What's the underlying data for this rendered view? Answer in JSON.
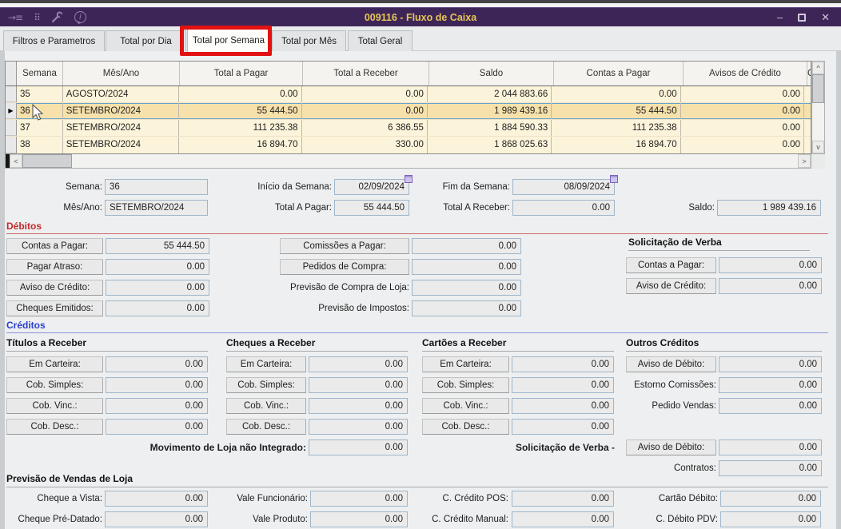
{
  "titlebar": {
    "title": "009116 - Fluxo de Caixa"
  },
  "icons": {
    "goto": "→≡",
    "status": "⠿",
    "info": "i",
    "minimize": "–",
    "close": "✕",
    "scroll_up": "^",
    "scroll_down": "v",
    "scroll_left": "<",
    "scroll_right": ">",
    "row_marker": "▶",
    "calendar": "calendar-grid"
  },
  "tabs": [
    {
      "label": "Filtros e Parametros"
    },
    {
      "label": "Total por Dia"
    },
    {
      "label": "Total por Semana"
    },
    {
      "label": "Total por Mês"
    },
    {
      "label": "Total Geral"
    }
  ],
  "active_tab": "Total por Semana",
  "table": {
    "headers": [
      "Semana",
      "Mês/Ano",
      "Total a Pagar",
      "Total a Receber",
      "Saldo",
      "Contas a Pagar",
      "Avisos de Crédito"
    ],
    "partial_header": "C",
    "selected_row": 1,
    "rows": [
      [
        "35",
        "AGOSTO/2024",
        "0.00",
        "0.00",
        "2 044 883.66",
        "0.00",
        "0.00"
      ],
      [
        "36",
        "SETEMBRO/2024",
        "55 444.50",
        "0.00",
        "1 989 439.16",
        "55 444.50",
        "0.00"
      ],
      [
        "37",
        "SETEMBRO/2024",
        "111 235.38",
        "6 386.55",
        "1 884 590.33",
        "111 235.38",
        "0.00"
      ],
      [
        "38",
        "SETEMBRO/2024",
        "16 894.70",
        "330.00",
        "1 868 025.63",
        "16 894.70",
        "0.00"
      ]
    ]
  },
  "summary": {
    "semana": {
      "label": "Semana:",
      "value": "36"
    },
    "inicio": {
      "label": "Início da Semana:",
      "value": "02/09/2024"
    },
    "fim": {
      "label": "Fim da Semana:",
      "value": "08/09/2024"
    },
    "mes_ano": {
      "label": "Mês/Ano:",
      "value": "SETEMBRO/2024"
    },
    "total_pagar": {
      "label": "Total A Pagar:",
      "value": "55 444.50"
    },
    "total_receber": {
      "label": "Total A Receber:",
      "value": "0.00"
    },
    "saldo": {
      "label": "Saldo:",
      "value": "1 989 439.16"
    }
  },
  "debitos": {
    "title": "Débitos",
    "contas_pagar": {
      "label": "Contas a Pagar:",
      "value": "55 444.50"
    },
    "pagar_atraso": {
      "label": "Pagar Atraso:",
      "value": "0.00"
    },
    "aviso_credito": {
      "label": "Aviso de Crédito:",
      "value": "0.00"
    },
    "cheques_emitidos": {
      "label": "Cheques Emitidos:",
      "value": "0.00"
    },
    "comissoes_pagar": {
      "label": "Comissões a Pagar:",
      "value": "0.00"
    },
    "pedidos_compra": {
      "label": "Pedidos de Compra:",
      "value": "0.00"
    },
    "previsao_compra_loja": {
      "label": "Previsão de Compra de Loja:",
      "value": "0.00"
    },
    "previsao_impostos": {
      "label": "Previsão de Impostos:",
      "value": "0.00"
    },
    "verba": {
      "title": "Solicitação de Verba",
      "contas_pagar": {
        "label": "Contas a Pagar:",
        "value": "0.00"
      },
      "aviso_credito": {
        "label": "Aviso de Crédito:",
        "value": "0.00"
      }
    }
  },
  "creditos": {
    "title": "Créditos",
    "titulos": {
      "title": "Títulos a Receber",
      "em_carteira": {
        "label": "Em Carteira:",
        "value": "0.00"
      },
      "cob_simples": {
        "label": "Cob. Simples:",
        "value": "0.00"
      },
      "cob_vinc": {
        "label": "Cob. Vinc.:",
        "value": "0.00"
      },
      "cob_desc": {
        "label": "Cob. Desc.:",
        "value": "0.00"
      }
    },
    "cheques": {
      "title": "Cheques a Receber",
      "em_carteira": {
        "label": "Em Carteira:",
        "value": "0.00"
      },
      "cob_simples": {
        "label": "Cob. Simples:",
        "value": "0.00"
      },
      "cob_vinc": {
        "label": "Cob. Vinc.:",
        "value": "0.00"
      },
      "cob_desc": {
        "label": "Cob. Desc.:",
        "value": "0.00"
      }
    },
    "cartoes": {
      "title": "Cartões a Receber",
      "em_carteira": {
        "label": "Em Carteira:",
        "value": "0.00"
      },
      "cob_simples": {
        "label": "Cob. Simples:",
        "value": "0.00"
      },
      "cob_vinc": {
        "label": "Cob. Vinc.:",
        "value": "0.00"
      },
      "cob_desc": {
        "label": "Cob. Desc.:",
        "value": "0.00"
      }
    },
    "outros": {
      "title": "Outros Créditos",
      "aviso_debito": {
        "label": "Aviso de Débito:",
        "value": "0.00"
      },
      "estorno_comissoes": {
        "label": "Estorno Comissões:",
        "value": "0.00"
      },
      "pedido_vendas": {
        "label": "Pedido Vendas:",
        "value": "0.00"
      }
    },
    "movimento": {
      "label": "Movimento de Loja não Integrado:",
      "value": "0.00"
    },
    "verba": {
      "label": "Solicitação de Verba -",
      "aviso_debito": {
        "label": "Aviso de Débito:",
        "value": "0.00"
      },
      "contratos": {
        "label": "Contratos:",
        "value": "0.00"
      }
    }
  },
  "previsao": {
    "title": "Previsão de Vendas de Loja",
    "cheque_vista": {
      "label": "Cheque a Vista:",
      "value": "0.00"
    },
    "vale_funcionario": {
      "label": "Vale Funcionário:",
      "value": "0.00"
    },
    "credito_pos": {
      "label": "C. Crédito POS:",
      "value": "0.00"
    },
    "cartao_debito": {
      "label": "Cartão Débito:",
      "value": "0.00"
    },
    "cheque_pre": {
      "label": "Cheque Pré-Datado:",
      "value": "0.00"
    },
    "vale_produto": {
      "label": "Vale Produto:",
      "value": "0.00"
    },
    "credito_manual": {
      "label": "C. Crédito Manual:",
      "value": "0.00"
    },
    "debito_pdv": {
      "label": "C. Débito PDV:",
      "value": "0.00"
    }
  },
  "colors": {
    "titlebar_bg": "#3e2558",
    "title_text": "#e5c654",
    "annotation_red": "#e21212",
    "debitos_red": "#c42a2a",
    "creditos_blue": "#2a3fd0",
    "row_bg": "#fcf4da",
    "selected_row_bg": "#f6e1ab",
    "selection_border": "#68a2cd"
  }
}
